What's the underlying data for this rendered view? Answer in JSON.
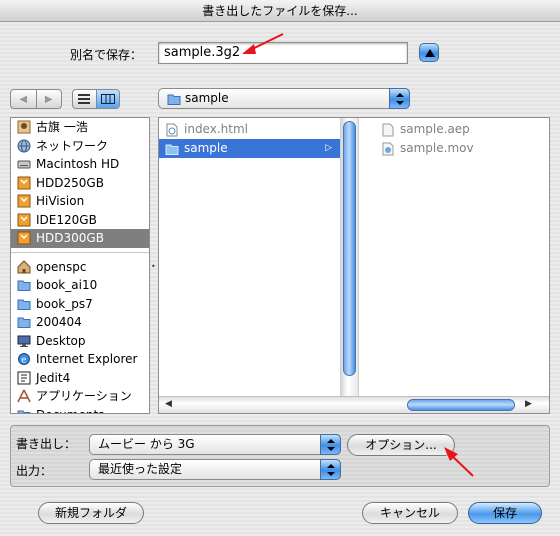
{
  "window": {
    "title": "書き出したファイルを保存..."
  },
  "save_as": {
    "label": "別名で保存：",
    "value": "sample.3g2"
  },
  "toolbar": {
    "back_icon": "back-arrow",
    "forward_icon": "forward-arrow",
    "list_view_icon": "list-view",
    "column_view_icon": "column-view"
  },
  "location": {
    "folder": "sample"
  },
  "sidebar": {
    "volumes": [
      {
        "label": "古旗 一浩",
        "icon": "home-user"
      },
      {
        "label": "ネットワーク",
        "icon": "network"
      },
      {
        "label": "Macintosh HD",
        "icon": "hard-drive"
      },
      {
        "label": "HDD250GB",
        "icon": "external-drive"
      },
      {
        "label": "HiVision",
        "icon": "external-drive"
      },
      {
        "label": "IDE120GB",
        "icon": "external-drive"
      },
      {
        "label": "HDD300GB",
        "icon": "external-drive"
      }
    ],
    "places": [
      {
        "label": "openspc",
        "icon": "home"
      },
      {
        "label": "book_ai10",
        "icon": "folder"
      },
      {
        "label": "book_ps7",
        "icon": "folder"
      },
      {
        "label": "200404",
        "icon": "folder"
      },
      {
        "label": "Desktop",
        "icon": "desktop"
      },
      {
        "label": "Internet Explorer",
        "icon": "ie"
      },
      {
        "label": "Jedit4",
        "icon": "app"
      },
      {
        "label": "アプリケーション",
        "icon": "applications"
      },
      {
        "label": "Documents",
        "icon": "folder"
      }
    ]
  },
  "browser": {
    "column1": [
      {
        "label": "index.html",
        "icon": "document"
      },
      {
        "label": "sample",
        "icon": "folder"
      }
    ],
    "column2": [
      {
        "label": "sample.aep",
        "icon": "document"
      },
      {
        "label": "sample.mov",
        "icon": "movie"
      }
    ]
  },
  "export": {
    "label": "書き出し：",
    "value": "ムービー から 3G",
    "options_button": "オプション...",
    "output_label": "出力：",
    "output_value": "最近使った設定"
  },
  "buttons": {
    "new_folder": "新規フォルダ",
    "cancel": "キャンセル",
    "save": "保存"
  },
  "colors": {
    "selection": "#3875d7",
    "sidebar_selection": "#7f7f7f",
    "accent": "#4a98ea",
    "annotation": "#e8141a"
  }
}
